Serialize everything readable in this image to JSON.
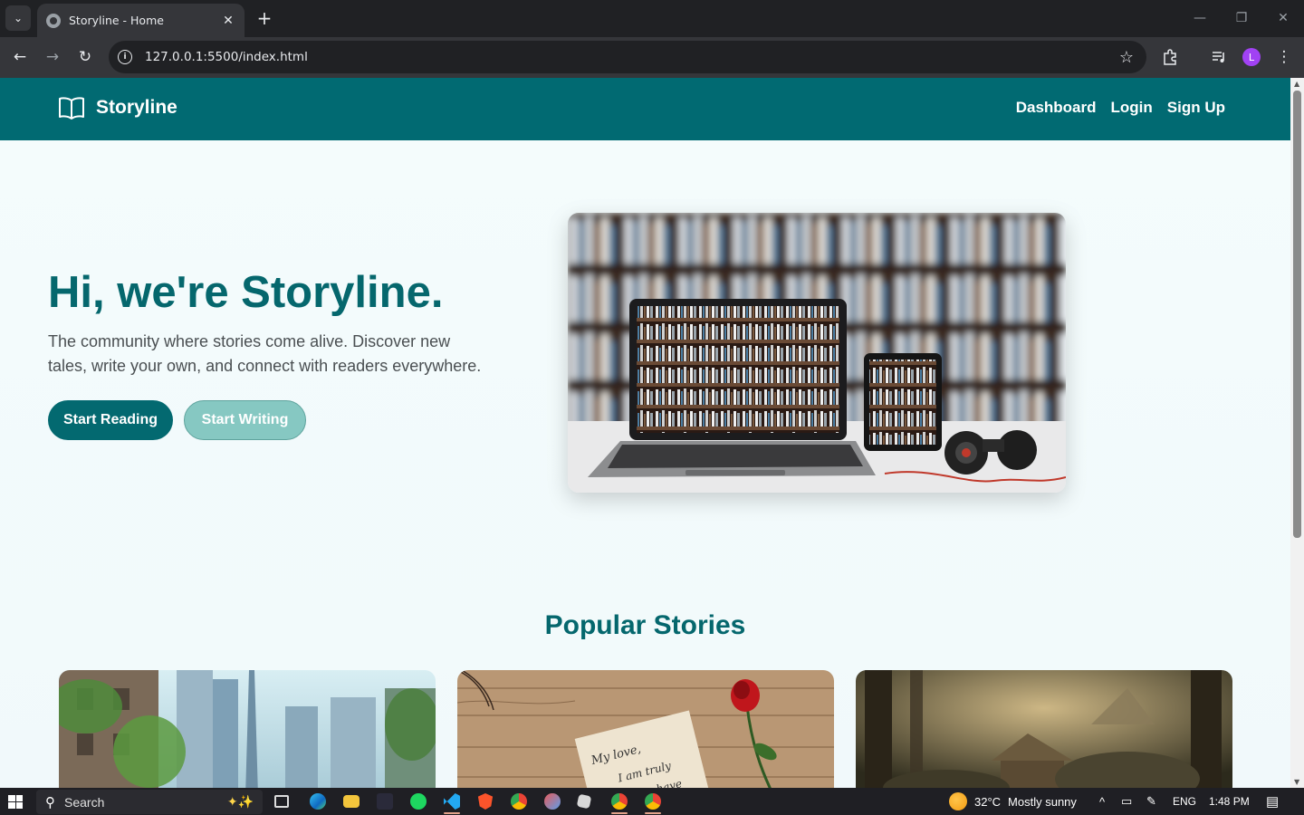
{
  "browser": {
    "tab_title": "Storyline - Home",
    "url": "127.0.0.1:5500/index.html",
    "profile_initial": "L"
  },
  "site": {
    "brand": "Storyline",
    "nav": [
      "Dashboard",
      "Login",
      "Sign Up"
    ],
    "colors": {
      "primary": "#016a72",
      "accent_button": "#86c8c2",
      "heading": "#05676d"
    }
  },
  "hero": {
    "title": "Hi, we're Storyline.",
    "subtitle": "The community where stories come alive. Discover new tales, write your own, and connect with readers everywhere.",
    "primary_button": "Start Reading",
    "secondary_button": "Start Writing"
  },
  "popular": {
    "heading": "Popular Stories",
    "card_images": [
      "overgrown-city-image",
      "love-letter-rose-image",
      "forest-ruins-image"
    ],
    "letter_line1": "My love,",
    "letter_line2": "I am truly",
    "letter_line3": "glad to have"
  },
  "taskbar": {
    "search_placeholder": "Search",
    "weather": "32°C",
    "weather_desc": "Mostly sunny",
    "language": "ENG",
    "time": "1:48 PM"
  }
}
